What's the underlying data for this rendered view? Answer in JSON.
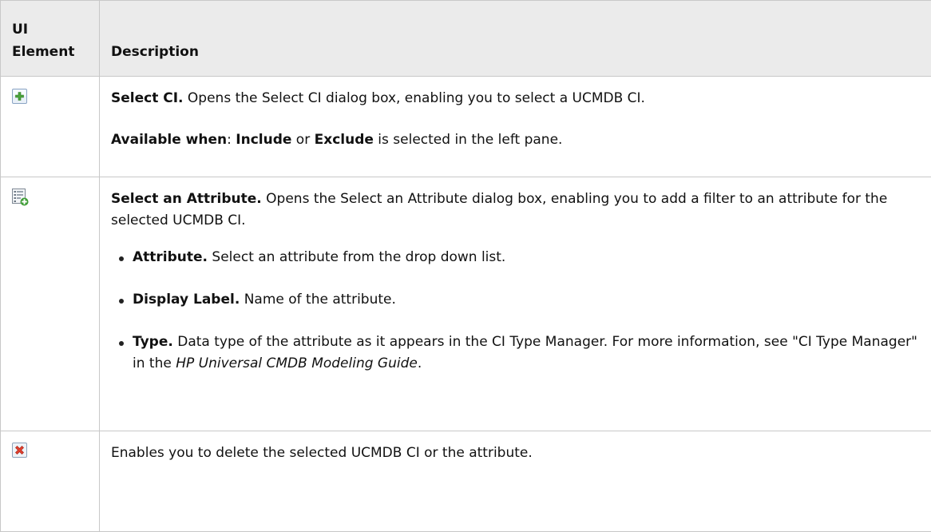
{
  "header": {
    "col1": "UI Element",
    "col2": "Description"
  },
  "rows": [
    {
      "icon": "add-icon",
      "title": "Select CI.",
      "text": " Opens the Select CI dialog box, enabling you to select a UCMDB CI.",
      "avail_label": "Available when",
      "avail_sep": ": ",
      "avail_include": "Include",
      "avail_or": " or ",
      "avail_exclude": "Exclude",
      "avail_rest": " is selected in the left pane."
    },
    {
      "icon": "select-attribute-icon",
      "title": "Select an Attribute.",
      "text": " Opens the Select an Attribute dialog box, enabling you to add a filter to an attribute for the selected UCMDB CI.",
      "bullets": [
        {
          "title": "Attribute.",
          "text": " Select an attribute from the drop down list."
        },
        {
          "title": "Display Label.",
          "text": " Name of the attribute."
        },
        {
          "title": "Type.",
          "text": " Data type of the attribute as it appears in the CI Type Manager. For more information, see \"CI Type Manager\" in the ",
          "italic": "HP Universal CMDB Modeling Guide",
          "end": "."
        }
      ]
    },
    {
      "icon": "delete-icon",
      "text": "Enables you to delete the selected UCMDB CI or the attribute."
    }
  ]
}
